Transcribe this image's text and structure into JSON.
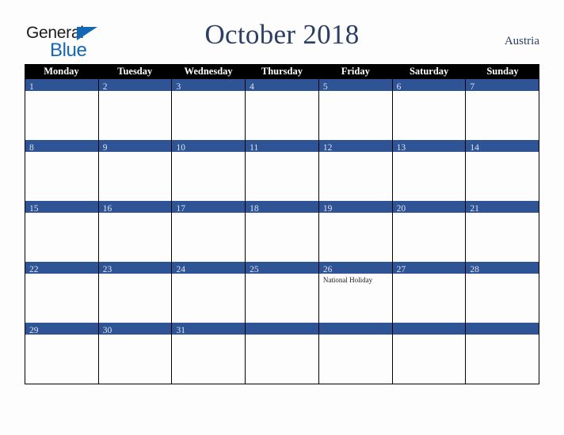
{
  "brand": {
    "name_top": "General",
    "name_bottom": "Blue",
    "triangle_icon": "brand-triangle-icon",
    "color": "#1268b3"
  },
  "header": {
    "title": "October 2018",
    "region": "Austria",
    "title_color": "#2c3e63"
  },
  "calendar": {
    "month": "October",
    "year": "2018",
    "weekday_headers": [
      "Monday",
      "Tuesday",
      "Wednesday",
      "Thursday",
      "Friday",
      "Saturday",
      "Sunday"
    ],
    "header_bg": "#000000",
    "day_band_bg": "#2e5496",
    "weeks": [
      [
        {
          "day": "1",
          "event": ""
        },
        {
          "day": "2",
          "event": ""
        },
        {
          "day": "3",
          "event": ""
        },
        {
          "day": "4",
          "event": ""
        },
        {
          "day": "5",
          "event": ""
        },
        {
          "day": "6",
          "event": ""
        },
        {
          "day": "7",
          "event": ""
        }
      ],
      [
        {
          "day": "8",
          "event": ""
        },
        {
          "day": "9",
          "event": ""
        },
        {
          "day": "10",
          "event": ""
        },
        {
          "day": "11",
          "event": ""
        },
        {
          "day": "12",
          "event": ""
        },
        {
          "day": "13",
          "event": ""
        },
        {
          "day": "14",
          "event": ""
        }
      ],
      [
        {
          "day": "15",
          "event": ""
        },
        {
          "day": "16",
          "event": ""
        },
        {
          "day": "17",
          "event": ""
        },
        {
          "day": "18",
          "event": ""
        },
        {
          "day": "19",
          "event": ""
        },
        {
          "day": "20",
          "event": ""
        },
        {
          "day": "21",
          "event": ""
        }
      ],
      [
        {
          "day": "22",
          "event": ""
        },
        {
          "day": "23",
          "event": ""
        },
        {
          "day": "24",
          "event": ""
        },
        {
          "day": "25",
          "event": ""
        },
        {
          "day": "26",
          "event": "National Holiday"
        },
        {
          "day": "27",
          "event": ""
        },
        {
          "day": "28",
          "event": ""
        }
      ],
      [
        {
          "day": "29",
          "event": ""
        },
        {
          "day": "30",
          "event": ""
        },
        {
          "day": "31",
          "event": ""
        },
        {
          "day": "",
          "event": ""
        },
        {
          "day": "",
          "event": ""
        },
        {
          "day": "",
          "event": ""
        },
        {
          "day": "",
          "event": ""
        }
      ]
    ]
  }
}
